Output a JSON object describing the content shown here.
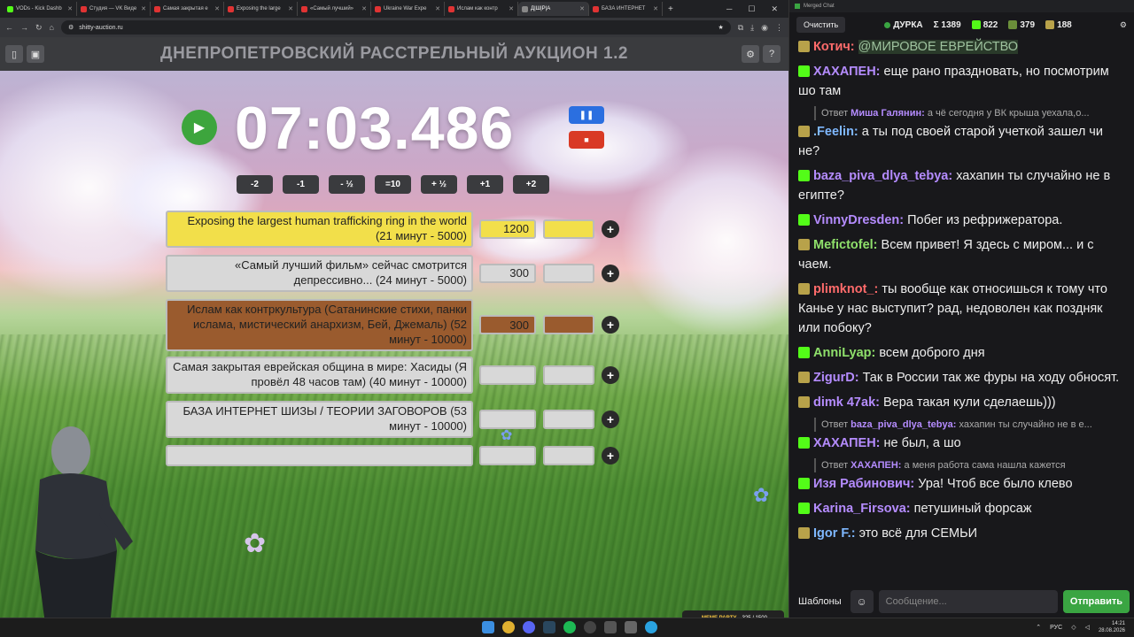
{
  "browser": {
    "tabs": [
      {
        "title": "VODs - Kick Dashb",
        "color": "#53fc18"
      },
      {
        "title": "Студия — VK Виде",
        "color": "#e03333"
      },
      {
        "title": "Самая закрытая е",
        "color": "#e03333"
      },
      {
        "title": "Exposing the large",
        "color": "#e03333"
      },
      {
        "title": "«Самый лучший»",
        "color": "#e03333"
      },
      {
        "title": "Ukraine War Expe",
        "color": "#e03333"
      },
      {
        "title": "Ислам как контр",
        "color": "#e03333"
      },
      {
        "title": "Д|Ш|Р|А",
        "color": "#888888"
      },
      {
        "title": "БАЗА ИНТЕРНЕТ",
        "color": "#e03333"
      }
    ],
    "url": "shitty-auction.ru"
  },
  "auction": {
    "title": "ДНЕПРОПЕТРОВСКИЙ РАССТРЕЛЬНЫЙ АУКЦИОН 1.2",
    "timer": "07:03.486",
    "steps": [
      "-2",
      "-1",
      "- ½",
      "=10",
      "+ ½",
      "+1",
      "+2"
    ],
    "lots": [
      {
        "name": "Exposing the largest human trafficking ring in the world (21 минут - 5000)",
        "amount": "1200",
        "bg": "#f2df4a"
      },
      {
        "name": "«Самый лучший фильм» сейчас смотрится депрессивно... (24 минут - 5000)",
        "amount": "300",
        "bg": "#d8d8d8"
      },
      {
        "name": "Ислам как контркультура (Сатанинские стихи, панки ислама, мистический анархизм,  Бей, Джемаль) (52 минут - 10000)",
        "amount": "300",
        "bg": "#9a5b2e"
      },
      {
        "name": "Самая закрытая еврейская община в мире: Хасиды (Я провёл 48 часов там) (40 минут - 10000)",
        "amount": "",
        "bg": "#d8d8d8"
      },
      {
        "name": "БАЗА ИНТЕРНЕТ ШИЗЫ / ТЕОРИИ ЗАГОВОРОВ (53 минут - 10000)",
        "amount": "",
        "bg": "#d8d8d8"
      },
      {
        "name": "",
        "amount": "",
        "bg": "#d8d8d8"
      }
    ]
  },
  "chat": {
    "window_title": "Merged Chat",
    "clear_label": "Очистить",
    "channel": "ДУРКА",
    "total": "Σ 1389",
    "kick_count": "822",
    "twitch_count": "379",
    "vk_count": "188",
    "messages": [
      {
        "type": "msg",
        "nick": "Котич:",
        "color": "#ff6b6b",
        "text": "@МИРОВОЕ ЕВРЕЙСТВО",
        "badge": "#b8a24a"
      },
      {
        "type": "msg",
        "nick": "ХАХАПЕН:",
        "color": "#b58cff",
        "text": "еще рано праздновать, но посмотрим шо там",
        "badge": "#53fc18"
      },
      {
        "type": "reply",
        "nick": "Миша Галянин:",
        "text": "а чё сегодня у ВК крыша уехала,о..."
      },
      {
        "type": "msg",
        "nick": ".Feelin:",
        "color": "#7fb8ff",
        "text": "а ты под своей старой учеткой зашел чи не?",
        "badge": "#b8a24a"
      },
      {
        "type": "msg",
        "nick": "baza_piva_dlya_tebya:",
        "color": "#b58cff",
        "text": "хахапин ты случайно не в египте?",
        "badge": "#53fc18"
      },
      {
        "type": "msg",
        "nick": "VinnyDresden:",
        "color": "#b58cff",
        "text": "Побег из рефрижератора.",
        "badge": "#53fc18"
      },
      {
        "type": "msg",
        "nick": "Mefictofel:",
        "color": "#8fe06b",
        "text": "Всем привет! Я здесь с миром... и с чаем.",
        "badge": "#b8a24a"
      },
      {
        "type": "msg",
        "nick": "plimknot_:",
        "color": "#ff6b6b",
        "text": "ты вообще как относишься к тому что Канье у нас выступит? рад, недоволен как поздняк или побоку?",
        "badge": "#b8a24a"
      },
      {
        "type": "msg",
        "nick": "AnniLyap:",
        "color": "#8fe06b",
        "text": "всем доброго дня",
        "badge": "#53fc18"
      },
      {
        "type": "msg",
        "nick": "ZigurD:",
        "color": "#b58cff",
        "text": "Так в России так же фуры на ходу обносят.",
        "badge": "#b8a24a"
      },
      {
        "type": "msg",
        "nick": "dimk 47ak:",
        "color": "#b58cff",
        "text": "Вера такая кули сделаешь)))",
        "badge": "#b8a24a"
      },
      {
        "type": "reply",
        "nick": "baza_piva_dlya_tebya:",
        "text": "хахапин ты случайно не в е..."
      },
      {
        "type": "msg",
        "nick": "ХАХАПЕН:",
        "color": "#b58cff",
        "text": "не был, а шо",
        "badge": "#53fc18"
      },
      {
        "type": "reply",
        "nick": "ХАХАПЕН:",
        "text": "а меня работа сама нашла кажется"
      },
      {
        "type": "msg",
        "nick": "Изя Рабинович:",
        "color": "#b58cff",
        "text": "Ура! Чтоб все было клево",
        "badge": "#53fc18"
      },
      {
        "type": "msg",
        "nick": "Karina_Firsova:",
        "color": "#b58cff",
        "text": "петушиный форсаж",
        "badge": "#53fc18"
      },
      {
        "type": "msg",
        "nick": "Igor F.:",
        "color": "#7fb8ff",
        "text": "это всё для СЕМЬИ",
        "badge": "#b8a24a"
      }
    ],
    "templates_label": "Шаблоны",
    "input_placeholder": "Сообщение...",
    "send_label": "Отправить"
  },
  "reply_prefix": "Ответ",
  "widget": {
    "label": "MEME PARTY",
    "progress": "325 / 1500"
  },
  "taskbar": {
    "lang": "РУС",
    "time": "14:21",
    "date": "28.08.2026"
  }
}
